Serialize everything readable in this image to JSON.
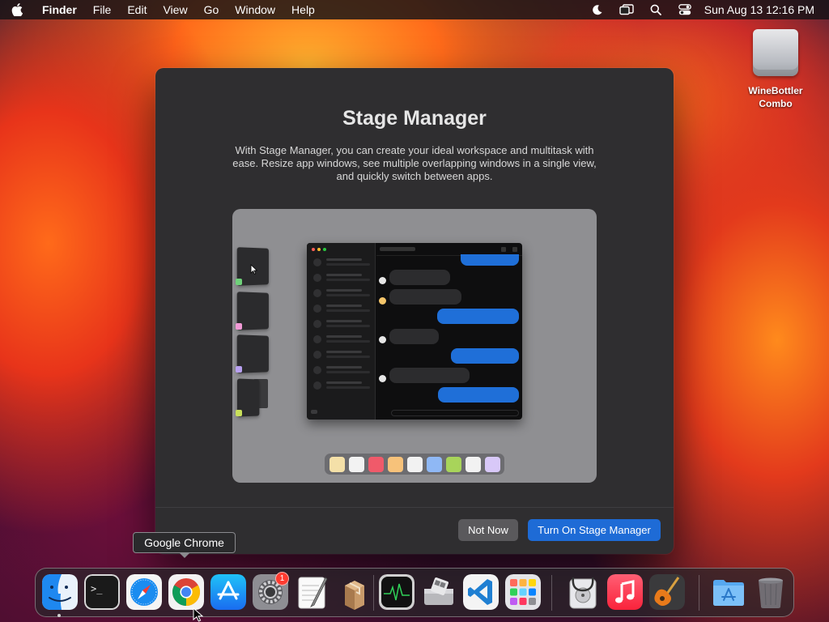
{
  "menubar": {
    "apple_icon": "apple-logo-icon",
    "app_name": "Finder",
    "menus": [
      "File",
      "Edit",
      "View",
      "Go",
      "Window",
      "Help"
    ],
    "status_icons": [
      "focus-moon-icon",
      "stage-manager-icon",
      "spotlight-search-icon",
      "control-center-icon"
    ],
    "clock": "Sun Aug 13  12:16 PM"
  },
  "desktop": {
    "icons": [
      {
        "label_line1": "WineBottler",
        "label_line2": "Combo",
        "icon": "external-drive-icon"
      }
    ]
  },
  "dialog": {
    "title": "Stage Manager",
    "description": "With Stage Manager, you can create your ideal workspace and multitask with ease. Resize app windows, see multiple overlapping windows in a single view, and quickly switch between apps.",
    "preview": {
      "thumbnail_colors": [
        "#6fd17a",
        "#f19ad6",
        "#b8a0f0",
        "#c8e05a"
      ],
      "dock_tile_colors": [
        "#f4e0a8",
        "#f2f2f2",
        "#f05a6a",
        "#f7c27a",
        "#f2f2f2",
        "#8fb8f5",
        "#a8d45a",
        "#f2f2f2",
        "#d8c8f8"
      ]
    },
    "buttons": {
      "secondary": "Not Now",
      "primary": "Turn On Stage Manager"
    },
    "accent_color": "#1e6bd6"
  },
  "tooltip": {
    "text": "Google Chrome"
  },
  "dock": {
    "apps": [
      {
        "name": "Finder",
        "icon": "finder-icon",
        "running": true
      },
      {
        "name": "Terminal",
        "icon": "terminal-icon",
        "running": false
      },
      {
        "name": "Safari",
        "icon": "safari-compass-icon",
        "running": false
      },
      {
        "name": "Google Chrome",
        "icon": "chrome-icon",
        "running": false
      },
      {
        "name": "App Store",
        "icon": "app-store-icon",
        "running": false
      },
      {
        "name": "System Settings",
        "icon": "gear-icon",
        "running": false,
        "badge": "1"
      },
      {
        "name": "TextEdit",
        "icon": "textedit-pen-icon",
        "running": false
      },
      {
        "name": "Archive Utility",
        "icon": "package-box-icon",
        "running": false
      },
      {
        "name": "Activity Monitor",
        "icon": "activity-monitor-icon",
        "running": false
      },
      {
        "name": "Boot Camp Assistant",
        "icon": "boot-camp-icon",
        "running": false
      },
      {
        "name": "Visual Studio Code",
        "icon": "vscode-icon",
        "running": false
      },
      {
        "name": "Launchpad",
        "icon": "launchpad-grid-icon",
        "running": false
      },
      {
        "name": "Disk Utility",
        "icon": "disk-utility-stethoscope-icon",
        "running": false
      },
      {
        "name": "Music",
        "icon": "music-note-icon",
        "running": false
      },
      {
        "name": "GarageBand",
        "icon": "guitar-icon",
        "running": false
      },
      {
        "name": "Applications",
        "icon": "applications-folder-icon",
        "running": false
      },
      {
        "name": "Trash",
        "icon": "trash-icon",
        "running": false
      }
    ]
  }
}
